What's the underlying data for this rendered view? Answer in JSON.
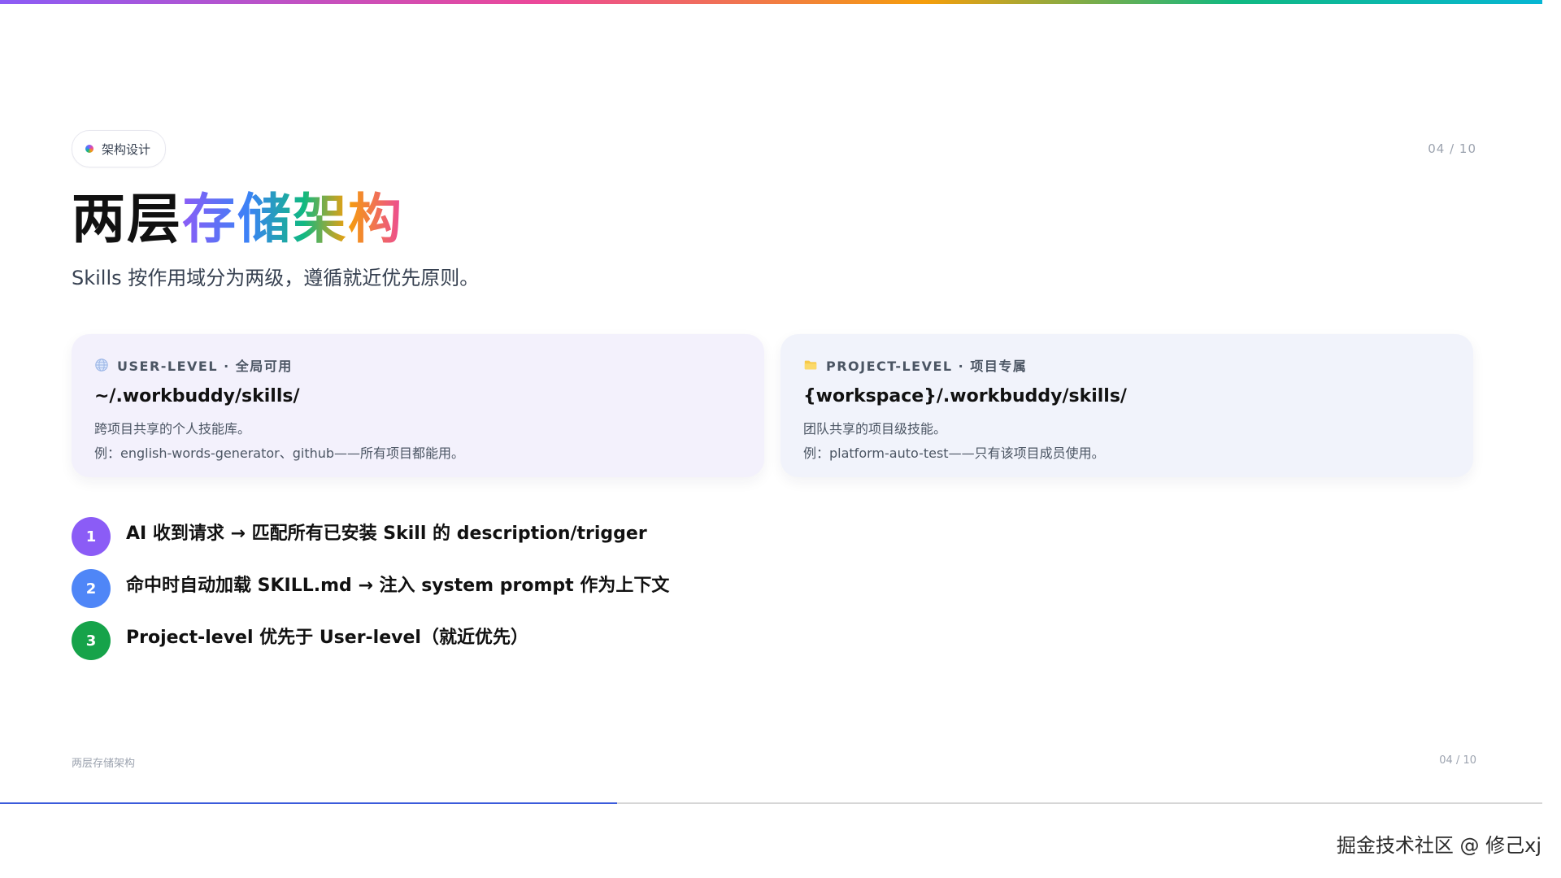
{
  "colors": {
    "step_1": "#8b5cf6",
    "step_2": "#4f86f7",
    "step_3": "#16a34a",
    "progress": "#3b5bdb"
  },
  "header": {
    "badge_label": "架构设计",
    "page_indicator": "04 / 10"
  },
  "title": {
    "plain": "两层",
    "highlight": "存储架构"
  },
  "subtitle": "Skills 按作用域分为两级，遵循就近优先原则。",
  "cards": [
    {
      "icon": "globe-icon",
      "label": "USER-LEVEL · 全局可用",
      "path": "~/.workbuddy/skills/",
      "description": "跨项目共享的个人技能库。",
      "example": "例：english-words-generator、github——所有项目都能用。"
    },
    {
      "icon": "folder-icon",
      "label": "PROJECT-LEVEL · 项目专属",
      "path": "{workspace}/.workbuddy/skills/",
      "description": "团队共享的项目级技能。",
      "example": "例：platform-auto-test——只有该项目成员使用。"
    }
  ],
  "steps": [
    {
      "number": "1",
      "text": "AI 收到请求 → 匹配所有已安装 Skill 的 description/trigger"
    },
    {
      "number": "2",
      "text": "命中时自动加载 SKILL.md → 注入 system prompt 作为上下文"
    },
    {
      "number": "3",
      "text": "Project-level 优先于 User-level（就近优先）"
    }
  ],
  "footer": {
    "left": "两层存储架构",
    "right": "04 / 10"
  },
  "progress": {
    "current": 4,
    "total": 10
  },
  "watermark": "掘金技术社区 @ 修己xj"
}
